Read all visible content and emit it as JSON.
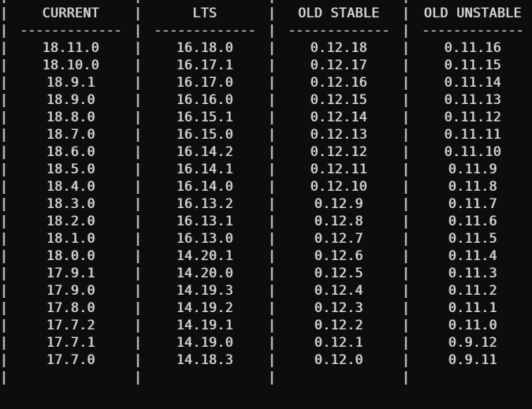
{
  "terminal": {
    "background_color": "#0d0d0d",
    "text_color": "#d8d8d8",
    "pipe_color": "#cbcbcb",
    "pipe_glyph": "|",
    "rule_glyph": "-------------",
    "blank_cell": ""
  },
  "table": {
    "columns": [
      "CURRENT",
      "LTS",
      "OLD STABLE",
      "OLD UNSTABLE"
    ],
    "rows": [
      [
        "18.11.0",
        "16.18.0",
        "0.12.18",
        "0.11.16"
      ],
      [
        "18.10.0",
        "16.17.1",
        "0.12.17",
        "0.11.15"
      ],
      [
        "18.9.1",
        "16.17.0",
        "0.12.16",
        "0.11.14"
      ],
      [
        "18.9.0",
        "16.16.0",
        "0.12.15",
        "0.11.13"
      ],
      [
        "18.8.0",
        "16.15.1",
        "0.12.14",
        "0.11.12"
      ],
      [
        "18.7.0",
        "16.15.0",
        "0.12.13",
        "0.11.11"
      ],
      [
        "18.6.0",
        "16.14.2",
        "0.12.12",
        "0.11.10"
      ],
      [
        "18.5.0",
        "16.14.1",
        "0.12.11",
        "0.11.9"
      ],
      [
        "18.4.0",
        "16.14.0",
        "0.12.10",
        "0.11.8"
      ],
      [
        "18.3.0",
        "16.13.2",
        "0.12.9",
        "0.11.7"
      ],
      [
        "18.2.0",
        "16.13.1",
        "0.12.8",
        "0.11.6"
      ],
      [
        "18.1.0",
        "16.13.0",
        "0.12.7",
        "0.11.5"
      ],
      [
        "18.0.0",
        "14.20.1",
        "0.12.6",
        "0.11.4"
      ],
      [
        "17.9.1",
        "14.20.0",
        "0.12.5",
        "0.11.3"
      ],
      [
        "17.9.0",
        "14.19.3",
        "0.12.4",
        "0.11.2"
      ],
      [
        "17.8.0",
        "14.19.2",
        "0.12.3",
        "0.11.1"
      ],
      [
        "17.7.2",
        "14.19.1",
        "0.12.2",
        "0.11.0"
      ],
      [
        "17.7.1",
        "14.19.0",
        "0.12.1",
        "0.9.12"
      ],
      [
        "17.7.0",
        "14.18.3",
        "0.12.0",
        "0.9.11"
      ]
    ]
  }
}
